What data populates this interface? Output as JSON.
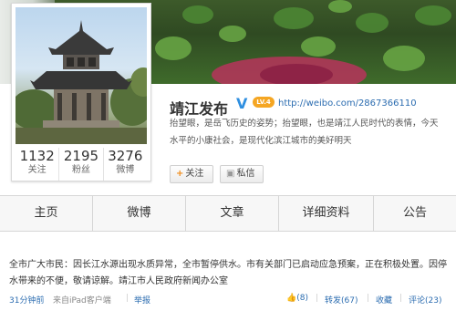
{
  "profile": {
    "name": "靖江发布",
    "verified_mark": "V",
    "level_badge": "LV.4",
    "url": "http://weibo.com/2867366110",
    "description": "抬望眼，是岳飞历史的姿势；抬望眼，也是靖江人民时代的表情，今天 水平的小康社会，是现代化滨江城市的美好明天",
    "description_line1": "抬望眼，是岳飞历史的姿势；抬望眼，也是靖江人民时代的表情，今天",
    "description_line2": "水平的小康社会，是现代化滨江城市的美好明天"
  },
  "stats": [
    {
      "num": "1132",
      "label": "关注"
    },
    {
      "num": "2195",
      "label": "粉丝"
    },
    {
      "num": "3276",
      "label": "微博"
    }
  ],
  "buttons": {
    "follow_icon": "+",
    "follow_label": "关注",
    "message_icon": "▣",
    "message_label": "私信"
  },
  "tabs": [
    "主页",
    "微博",
    "文章",
    "详细资料",
    "公告"
  ],
  "post": {
    "text": "全市广大市民：因长江水源出现水质异常，全市暂停供水。市有关部门已启动应急预案，正在积极处置。因停水带来的不便，敬请谅解。靖江市人民政府新闻办公室",
    "time": "31分钟前",
    "source": "来自iPad客户端",
    "report": "举报",
    "like": "(8)",
    "repost": "转发(67)",
    "collect": "收藏",
    "comment": "评论(23)"
  },
  "colors": {
    "link": "#2b6cb0",
    "verified": "#2f8fe0",
    "badge": "#f5a623"
  }
}
